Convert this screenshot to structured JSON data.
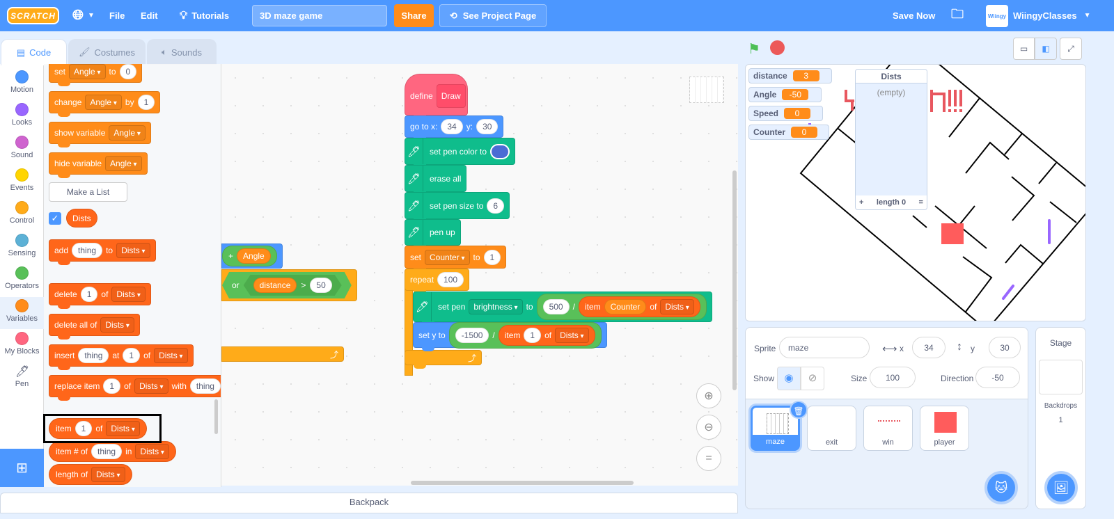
{
  "menubar": {
    "logo": "SCRATCH",
    "file": "File",
    "edit": "Edit",
    "tutorials": "Tutorials",
    "project_title": "3D maze game",
    "share": "Share",
    "see_project_page": "See Project Page",
    "save_now": "Save Now",
    "username": "WiingyClasses",
    "avatar_text": "Wiingy"
  },
  "tabs": {
    "code": "Code",
    "costumes": "Costumes",
    "sounds": "Sounds"
  },
  "categories": [
    {
      "label": "Motion",
      "color": "#4c97ff"
    },
    {
      "label": "Looks",
      "color": "#9966ff"
    },
    {
      "label": "Sound",
      "color": "#cf63cf"
    },
    {
      "label": "Events",
      "color": "#ffd500"
    },
    {
      "label": "Control",
      "color": "#ffab19"
    },
    {
      "label": "Sensing",
      "color": "#5cb1d6"
    },
    {
      "label": "Operators",
      "color": "#59c059"
    },
    {
      "label": "Variables",
      "color": "#ff8c1a",
      "selected": true
    },
    {
      "label": "My Blocks",
      "color": "#ff6680"
    },
    {
      "label": "Pen",
      "color": "pen"
    }
  ],
  "colors": {
    "variables": "#ff8c1a",
    "lists": "#ff661a",
    "motion": "#4c97ff",
    "pen": "#0fbd8c",
    "operators": "#59c059",
    "control": "#ffab19",
    "myblocks": "#ff6680",
    "accent": "#4c97ff"
  },
  "palette": {
    "make_list": "Make a List",
    "list_reporter": "Dists",
    "list_checked": true,
    "blocks": [
      {
        "category": "variables",
        "parts": [
          {
            "t": "set"
          },
          {
            "d": "Angle"
          },
          {
            "t": "to"
          },
          {
            "i": "0"
          }
        ]
      },
      {
        "category": "variables",
        "parts": [
          {
            "t": "change"
          },
          {
            "d": "Angle"
          },
          {
            "t": "by"
          },
          {
            "i": "1"
          }
        ]
      },
      {
        "category": "variables",
        "parts": [
          {
            "t": "show variable"
          },
          {
            "d": "Angle"
          }
        ]
      },
      {
        "category": "variables",
        "parts": [
          {
            "t": "hide variable"
          },
          {
            "d": "Angle"
          }
        ]
      },
      {
        "category": "lists",
        "parts": [
          {
            "t": "add"
          },
          {
            "i": "thing"
          },
          {
            "t": "to"
          },
          {
            "d": "Dists"
          }
        ]
      },
      {
        "category": "lists",
        "parts": [
          {
            "t": "delete"
          },
          {
            "i": "1"
          },
          {
            "t": "of"
          },
          {
            "d": "Dists"
          }
        ]
      },
      {
        "category": "lists",
        "parts": [
          {
            "t": "delete all of"
          },
          {
            "d": "Dists"
          }
        ]
      },
      {
        "category": "lists",
        "parts": [
          {
            "t": "insert"
          },
          {
            "i": "thing"
          },
          {
            "t": "at"
          },
          {
            "i": "1"
          },
          {
            "t": "of"
          },
          {
            "d": "Dists"
          }
        ]
      },
      {
        "category": "lists",
        "parts": [
          {
            "t": "replace item"
          },
          {
            "i": "1"
          },
          {
            "t": "of"
          },
          {
            "d": "Dists"
          },
          {
            "t": "with"
          },
          {
            "i": "thing"
          }
        ]
      },
      {
        "category": "lists",
        "reporter": true,
        "highlighted": true,
        "parts": [
          {
            "t": "item"
          },
          {
            "i": "1"
          },
          {
            "t": "of"
          },
          {
            "d": "Dists"
          }
        ]
      },
      {
        "category": "lists",
        "reporter": true,
        "parts": [
          {
            "t": "item # of"
          },
          {
            "i": "thing"
          },
          {
            "t": "in"
          },
          {
            "d": "Dists"
          }
        ]
      },
      {
        "category": "lists",
        "reporter": true,
        "parts": [
          {
            "t": "length of"
          },
          {
            "d": "Dists"
          }
        ]
      }
    ]
  },
  "script": {
    "define_label": "define",
    "define_name": "Draw",
    "blocks": [
      {
        "category": "motion",
        "parts": [
          {
            "t": "go to x:"
          },
          {
            "i": "34"
          },
          {
            "t": "y:"
          },
          {
            "i": "30"
          }
        ]
      },
      {
        "category": "pen",
        "pen": true,
        "parts": [
          {
            "t": "set pen color to"
          },
          {
            "c": "#4a6cd4"
          }
        ]
      },
      {
        "category": "pen",
        "pen": true,
        "parts": [
          {
            "t": "erase all"
          }
        ]
      },
      {
        "category": "pen",
        "pen": true,
        "parts": [
          {
            "t": "set pen size to"
          },
          {
            "i": "6"
          }
        ]
      },
      {
        "category": "pen",
        "pen": true,
        "parts": [
          {
            "t": "pen up"
          }
        ]
      },
      {
        "category": "variables",
        "parts": [
          {
            "t": "set"
          },
          {
            "d": "Counter"
          },
          {
            "t": "to"
          },
          {
            "i": "1"
          }
        ]
      },
      {
        "category": "control",
        "parts": [
          {
            "t": "repeat"
          },
          {
            "i": "100"
          }
        ]
      },
      {
        "category": "pen",
        "pen": true,
        "parts": [
          {
            "t": "set pen"
          },
          {
            "d": "brightness"
          },
          {
            "t": "to"
          },
          {
            "r": "operators",
            "parts": [
              {
                "i": "500"
              },
              {
                "t": "/"
              },
              {
                "r": "lists",
                "parts": [
                  {
                    "t": "item"
                  },
                  {
                    "r": "variables",
                    "parts": [
                      {
                        "t": "Counter"
                      }
                    ]
                  },
                  {
                    "t": "of"
                  },
                  {
                    "d": "Dists"
                  }
                ]
              }
            ]
          }
        ]
      },
      {
        "category": "motion",
        "parts": [
          {
            "t": "set y to"
          },
          {
            "r": "operators",
            "parts": [
              {
                "i": "-1500"
              },
              {
                "t": "/"
              },
              {
                "r": "lists",
                "parts": [
                  {
                    "t": "item"
                  },
                  {
                    "i": "1"
                  },
                  {
                    "t": "of"
                  },
                  {
                    "d": "Dists"
                  }
                ]
              }
            ]
          }
        ]
      },
      {
        "category": "motion",
        "parts": [
          {
            "r": "operators",
            "parts": [
              {
                "t": "+"
              },
              {
                "r": "variables",
                "parts": [
                  {
                    "t": "Angle"
                  }
                ]
              }
            ]
          }
        ]
      },
      {
        "category": "control",
        "parts": [
          {
            "h": "operators",
            "parts": [
              {
                "t": "or"
              },
              {
                "h": "operators",
                "parts": [
                  {
                    "r": "variables",
                    "parts": [
                      {
                        "t": "distance"
                      }
                    ]
                  },
                  {
                    "t": ">"
                  },
                  {
                    "i": "50"
                  }
                ]
              }
            ]
          }
        ]
      }
    ]
  },
  "backpack": "Backpack",
  "stage": {
    "monitors": [
      {
        "name": "distance",
        "value": "3"
      },
      {
        "name": "Angle",
        "value": "-50"
      },
      {
        "name": "Speed",
        "value": "0"
      },
      {
        "name": "Counter",
        "value": "0"
      }
    ],
    "list_monitor": {
      "title": "Dists",
      "empty": "(empty)",
      "add": "+",
      "length": "length 0",
      "resize": "="
    }
  },
  "sprite_info": {
    "sprite_label": "Sprite",
    "sprite_name": "maze",
    "x_label": "x",
    "x": "34",
    "y_label": "y",
    "y": "30",
    "show_label": "Show",
    "size_label": "Size",
    "size": "100",
    "direction_label": "Direction",
    "direction": "-50"
  },
  "sprites": [
    {
      "name": "maze",
      "selected": true
    },
    {
      "name": "exit"
    },
    {
      "name": "win"
    },
    {
      "name": "player"
    }
  ],
  "stage_panel": {
    "title": "Stage",
    "backdrops_label": "Backdrops",
    "backdrops_count": "1"
  }
}
